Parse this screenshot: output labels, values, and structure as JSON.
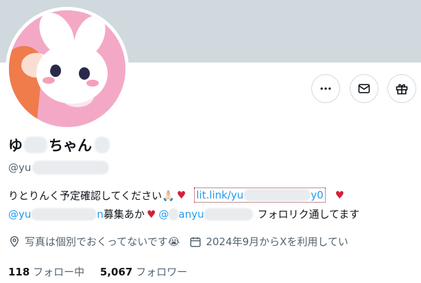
{
  "profile": {
    "display_name_start": "ゆ",
    "display_name_mid": "ちゃん",
    "handle_prefix": "@yu",
    "bio_line1_text": "りとりんく予定確認してください🙏🏻",
    "bio_line1_heart": "♥",
    "bio_link_text": "lit.link/yu",
    "bio_link_suffix": "y0",
    "bio_line2_mention1": "@yu",
    "bio_line2_mention1_tail": "n",
    "bio_line2_text": "募集あか",
    "bio_line2_heart": "♥",
    "bio_line2_mention2": "@",
    "bio_line2_mention2_mid": "anyu",
    "bio_line2_tail": "フォロリク通してます",
    "location": "写真は個別でおくってないです😭",
    "joined": "2024年9月からXを利用してい",
    "following_count": "118",
    "following_label": "フォロー中",
    "followers_count": "5,067",
    "followers_label": "フォロワー"
  },
  "icons": {
    "more": "more-icon",
    "message": "envelope-icon",
    "gift": "gift-icon",
    "location": "location-pin-icon",
    "calendar": "calendar-icon"
  },
  "colors": {
    "banner": "#cfd9de",
    "link": "#1d9bf0",
    "heart": "#d1203a",
    "secondary_text": "#536471"
  }
}
